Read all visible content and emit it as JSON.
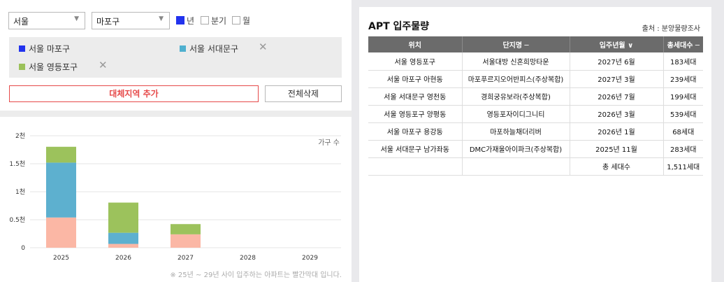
{
  "filters": {
    "city": "서울",
    "district": "마포구",
    "period_options": [
      {
        "label": "년",
        "checked": true
      },
      {
        "label": "분기",
        "checked": false
      },
      {
        "label": "월",
        "checked": false
      }
    ]
  },
  "regions": [
    {
      "label": "서울 마포구",
      "color": "#2233ee",
      "removable": false
    },
    {
      "label": "서울 서대문구",
      "color": "#4fb0cf",
      "removable": true
    },
    {
      "label": "서울 영등포구",
      "color": "#9bc15a",
      "removable": true
    }
  ],
  "buttons": {
    "add_region": "대체지역 추가",
    "delete_all": "전체삭제"
  },
  "chart_data": {
    "type": "bar",
    "stacked": true,
    "categories": [
      "2025",
      "2026",
      "2027",
      "2028",
      "2029"
    ],
    "series": [
      {
        "color": "#fbb7a5",
        "values": [
          540,
          68,
          239,
          0,
          0
        ]
      },
      {
        "color": "#5db0cf",
        "values": [
          980,
          199,
          0,
          0,
          0
        ]
      },
      {
        "color": "#9cc25c",
        "values": [
          283,
          539,
          183,
          0,
          0
        ]
      }
    ],
    "y_ticks": [
      "0",
      "0.5천",
      "1천",
      "1.5천",
      "2천"
    ],
    "ylim": [
      0,
      2000
    ],
    "legend_note": "가구 수",
    "grid": true
  },
  "chart_note": "※ 25년 ~ 29년 사이 입주하는 아파트는 빨간막대 입니다.",
  "apt": {
    "title": "APT 입주물량",
    "source": "출처 : 분양물량조사",
    "columns": [
      "위치",
      "단지명 ─",
      "입주년월 ∨",
      "총세대수 ─"
    ],
    "rows": [
      [
        "서울 영등포구",
        "서울대방 신혼희망타운",
        "2027년 6월",
        "183세대"
      ],
      [
        "서울 마포구 아현동",
        "마포푸르지오어반피스(주상복합)",
        "2027년 3월",
        "239세대"
      ],
      [
        "서울 서대문구 영천동",
        "경희궁유보라(주상복합)",
        "2026년 7월",
        "199세대"
      ],
      [
        "서울 영등포구 양평동",
        "영등포자이디그니티",
        "2026년 3월",
        "539세대"
      ],
      [
        "서울 마포구 용강동",
        "마포하늘채더리버",
        "2026년 1월",
        "68세대"
      ],
      [
        "서울 서대문구 남가좌동",
        "DMC가재울아이파크(주상복합)",
        "2025년 11월",
        "283세대"
      ]
    ],
    "total_label": "총 세대수",
    "total_value": "1,511세대"
  }
}
